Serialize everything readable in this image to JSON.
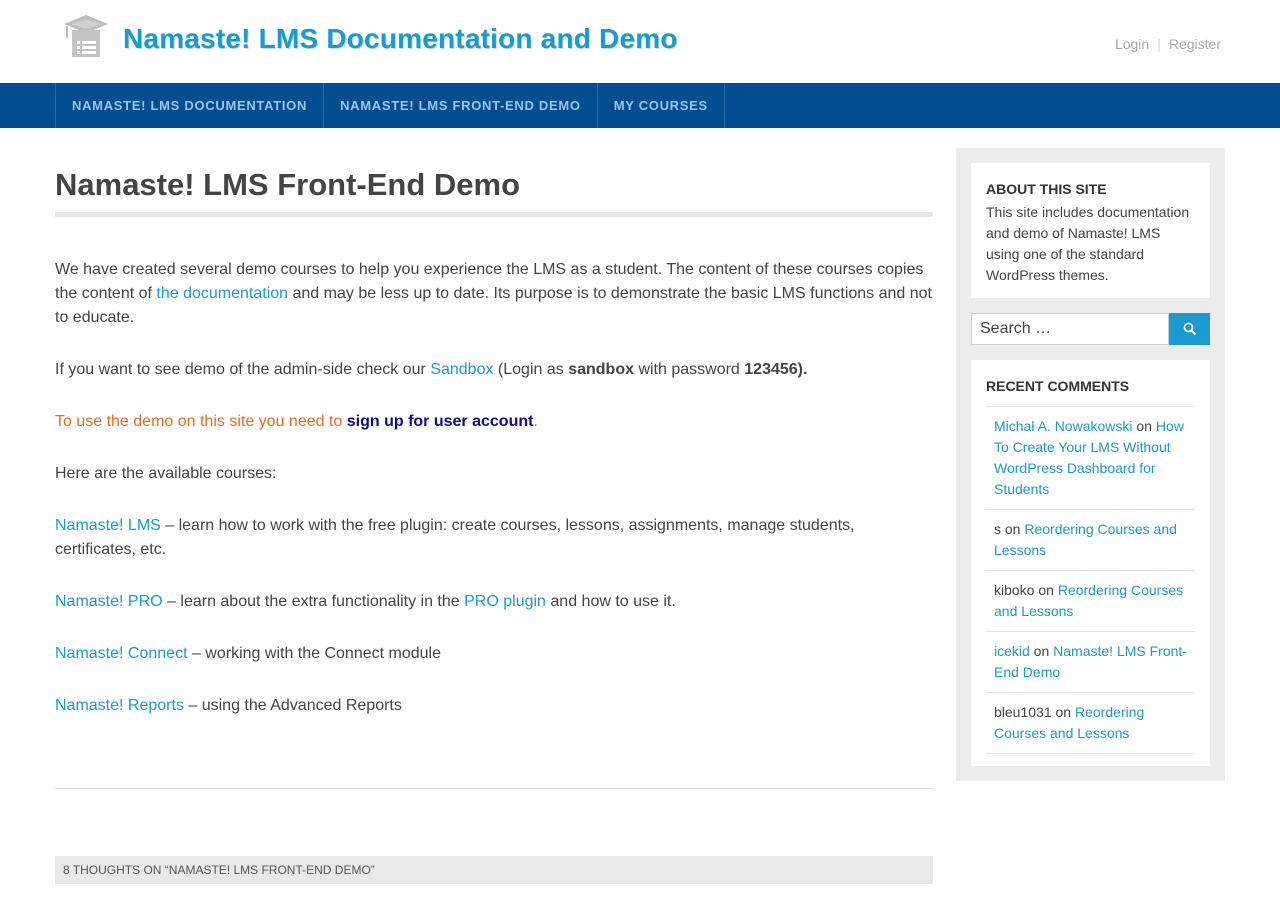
{
  "header": {
    "site_title": "Namaste! LMS Documentation and Demo",
    "login": "Login",
    "register": "Register"
  },
  "nav": {
    "items": [
      {
        "label": "Namaste! LMS Documentation"
      },
      {
        "label": "Namaste! LMS Front-End Demo"
      },
      {
        "label": "My Courses"
      }
    ]
  },
  "main": {
    "title": "Namaste! LMS Front-End Demo",
    "p1": {
      "before": "We have created several demo courses to help you experience the LMS as a student. The content of these courses copies the content of ",
      "link": "the documentation",
      "after": " and may be less up to date. Its purpose is to demonstrate the basic LMS functions and not to educate."
    },
    "p2": {
      "before": "If you want to see demo of the admin-side check our ",
      "link": "Sandbox",
      "middle1": " (Login as ",
      "bold1": "sandbox",
      "middle2": " with password ",
      "bold2": "123456)."
    },
    "p3": {
      "orange": "To use the demo on this site you need to ",
      "link": "sign up for user account",
      "after": "."
    },
    "p4": "Here are the available courses:",
    "courses": [
      {
        "link": "Namaste! LMS",
        "text": " – learn how to work with the free plugin: create courses, lessons, assignments, manage students, certificates, etc."
      },
      {
        "link": "Namaste! PRO",
        "text": " – learn about the extra functionality in the ",
        "link2": "PRO plugin",
        "text2": " and how to use it."
      },
      {
        "link": "Namaste! Connect",
        "text": " – working with the Connect module"
      },
      {
        "link": "Namaste! Reports",
        "text": " – using the Advanced Reports"
      }
    ],
    "comments_heading": "8 thoughts on “Namaste! LMS Front-End Demo”"
  },
  "sidebar": {
    "about_title": "About This Site",
    "about_text": "This site includes documentation and demo of Namaste! LMS using one of the standard WordPress themes.",
    "search_placeholder": "Search …",
    "recent_title": "Recent Comments",
    "comments": [
      {
        "author": "Michał A. Nowakowski",
        "author_link": true,
        "on": " on ",
        "post": "How To Create Your LMS Without WordPress Dashboard for Students"
      },
      {
        "author": "s",
        "author_link": false,
        "on": " on ",
        "post": "Reordering Courses and Lessons"
      },
      {
        "author": "kiboko",
        "author_link": false,
        "on": " on ",
        "post": "Reordering Courses and Lessons"
      },
      {
        "author": "icekid",
        "author_link": true,
        "on": " on ",
        "post": "Namaste! LMS Front-End Demo"
      },
      {
        "author": "bleu1031",
        "author_link": false,
        "on": " on ",
        "post": "Reordering Courses and Lessons"
      }
    ]
  },
  "colors": {
    "accent": "#1a9ad1",
    "nav_bg": "#004d91",
    "nav_text": "#9bc5ea",
    "orange": "#f26a1b",
    "dark_link": "#0b0b8a"
  },
  "icons": {
    "logo": "graduation-cap-icon",
    "search": "search-icon"
  }
}
